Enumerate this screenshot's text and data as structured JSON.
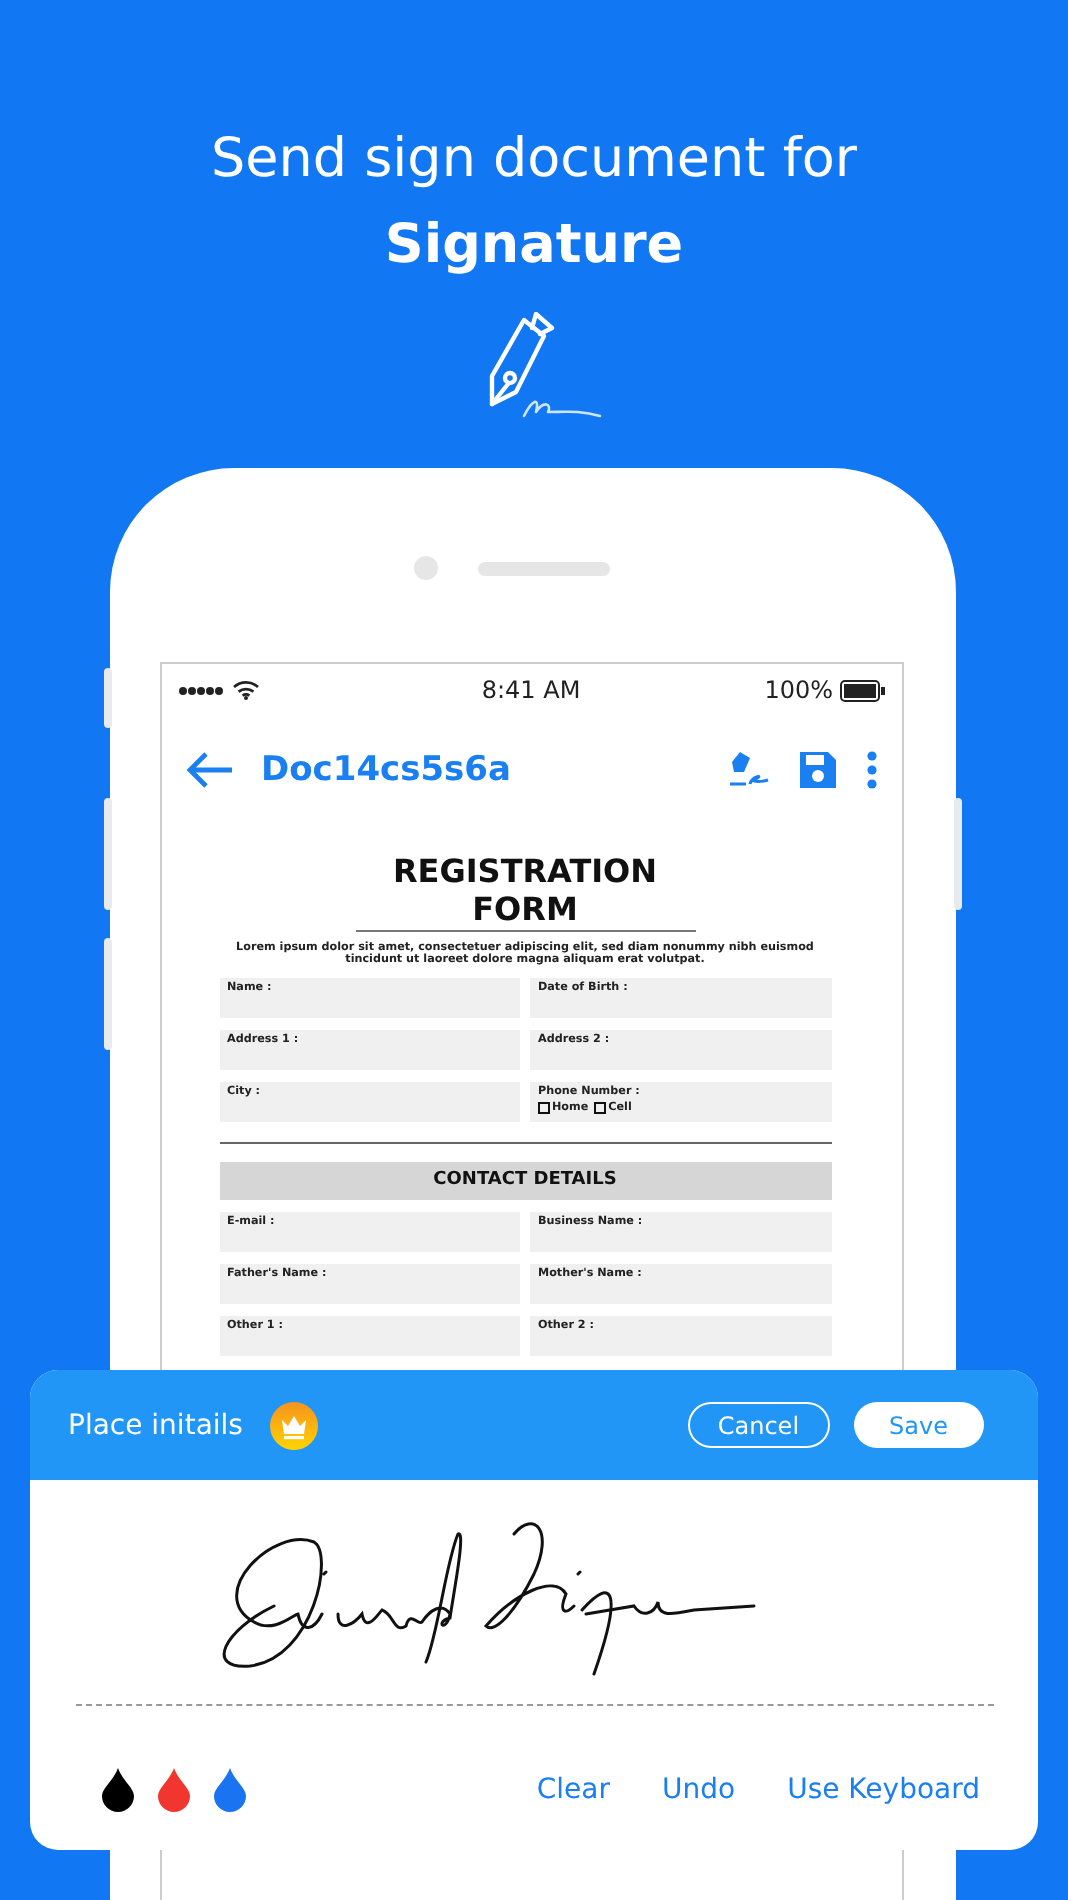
{
  "headline": {
    "line_1": "Send sign document for",
    "line_2": "Signature"
  },
  "status_bar": {
    "time": "8:41 AM",
    "battery": "100%"
  },
  "app_bar": {
    "title": "Doc14cs5s6a"
  },
  "form": {
    "title": "REGISTRATION FORM",
    "intro": "Lorem ipsum dolor sit amet, consectetuer adipiscing elit, sed diam nonummy nibh euismod tincidunt ut laoreet dolore magna aliquam erat volutpat.",
    "fields": [
      {
        "label": "Name :"
      },
      {
        "label": "Date of Birth :"
      },
      {
        "label": "Address 1 :"
      },
      {
        "label": "Address 2 :"
      },
      {
        "label": "City :"
      },
      {
        "label": "Phone Number :",
        "options": [
          {
            "label": "Home",
            "checked": false
          },
          {
            "label": "Cell",
            "checked": false
          }
        ]
      }
    ],
    "section_title": "CONTACT DETAILS",
    "contact_fields": [
      {
        "label": "E-mail :"
      },
      {
        "label": "Business Name :"
      },
      {
        "label": "Father's Name :"
      },
      {
        "label": "Mother's Name :"
      },
      {
        "label": "Other 1 :"
      },
      {
        "label": "Other 2 :"
      }
    ]
  },
  "signature_panel": {
    "title": "Place initails",
    "buttons": [
      "Cancel",
      "Save"
    ],
    "inks": [
      {
        "color": "#000000"
      },
      {
        "color": "#f0362f"
      },
      {
        "color": "#1a73f0"
      }
    ],
    "actions": [
      "Clear",
      "Undo",
      "Use Keyboard"
    ]
  }
}
